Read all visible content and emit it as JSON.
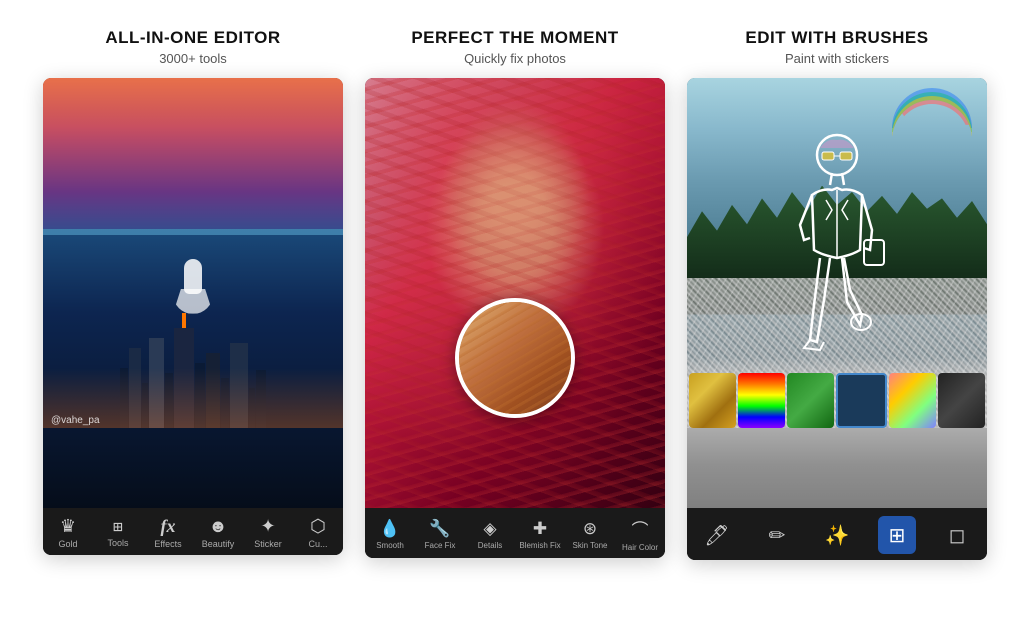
{
  "panels": [
    {
      "id": "all-in-one",
      "title": "ALL-IN-ONE EDITOR",
      "subtitle": "3000+ tools",
      "watermark": "@vahe_pa",
      "toolbar": [
        {
          "icon": "👑",
          "label": "Gold"
        },
        {
          "icon": "⊞",
          "label": "Tools"
        },
        {
          "icon": "fx",
          "label": "Effects"
        },
        {
          "icon": "☻",
          "label": "Beautify"
        },
        {
          "icon": "⭐",
          "label": "Sticker"
        },
        {
          "icon": "⬡",
          "label": "Cu..."
        }
      ]
    },
    {
      "id": "perfect-moment",
      "title": "PERFECT THE MOMENT",
      "subtitle": "Quickly fix photos",
      "toolbar": [
        {
          "icon": "💧",
          "label": "Smooth"
        },
        {
          "icon": "🔧",
          "label": "Face Fix"
        },
        {
          "icon": "◈",
          "label": "Details"
        },
        {
          "icon": "✚",
          "label": "Blemish Fix"
        },
        {
          "icon": "⊛",
          "label": "Skin Tone"
        },
        {
          "icon": "⌒",
          "label": "Hair Color"
        }
      ]
    },
    {
      "id": "edit-brushes",
      "title": "EDIT WITH BRUSHES",
      "subtitle": "Paint with stickers",
      "toolbar": [
        {
          "icon": "🖌",
          "label": "",
          "active": false
        },
        {
          "icon": "✏",
          "label": "",
          "active": false
        },
        {
          "icon": "✨",
          "label": "",
          "active": false
        },
        {
          "icon": "⊞",
          "label": "",
          "active": true
        },
        {
          "icon": "◻",
          "label": "",
          "active": false
        }
      ]
    }
  ]
}
